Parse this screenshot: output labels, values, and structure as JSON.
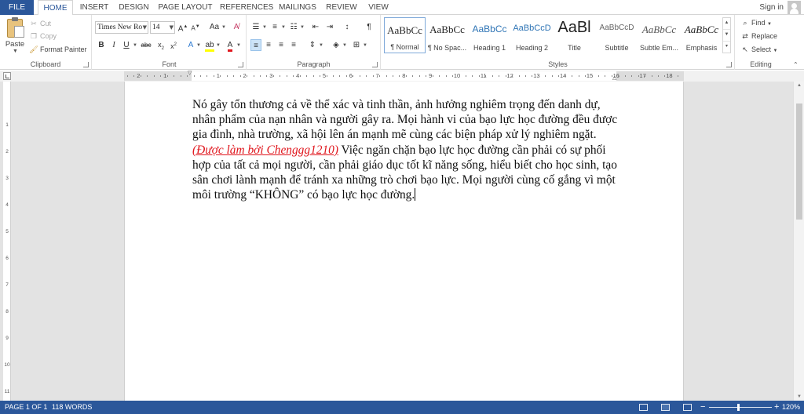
{
  "tabs": [
    "FILE",
    "HOME",
    "INSERT",
    "DESIGN",
    "PAGE LAYOUT",
    "REFERENCES",
    "MAILINGS",
    "REVIEW",
    "VIEW"
  ],
  "signin": "Sign in",
  "clipboard": {
    "label": "Clipboard",
    "paste": "Paste",
    "cut": "Cut",
    "copy": "Copy",
    "format_painter": "Format Painter"
  },
  "font": {
    "label": "Font",
    "name": "Times New Ro",
    "size": "14"
  },
  "paragraph": {
    "label": "Paragraph"
  },
  "styles": {
    "label": "Styles",
    "items": [
      {
        "preview": "AaBbCc",
        "name": "¶ Normal"
      },
      {
        "preview": "AaBbCc",
        "name": "¶ No Spac..."
      },
      {
        "preview": "AaBbCc",
        "name": "Heading 1"
      },
      {
        "preview": "AaBbCcD",
        "name": "Heading 2"
      },
      {
        "preview": "AaBl",
        "name": "Title"
      },
      {
        "preview": "AaBbCcD",
        "name": "Subtitle"
      },
      {
        "preview": "AaBbCc",
        "name": "Subtle Em..."
      },
      {
        "preview": "AaBbCc",
        "name": "Emphasis"
      }
    ]
  },
  "editing": {
    "label": "Editing",
    "find": "Find",
    "replace": "Replace",
    "select": "Select"
  },
  "ruler_numbers": [
    "2",
    "1",
    "1",
    "2",
    "3",
    "4",
    "5",
    "6",
    "7",
    "8",
    "9",
    "10",
    "11",
    "12",
    "13",
    "14",
    "15",
    "16",
    "17",
    "18"
  ],
  "vruler_numbers": [
    "1",
    "2",
    "3",
    "4",
    "5",
    "6",
    "7",
    "8",
    "9",
    "10",
    "11"
  ],
  "document": {
    "text_before": "Nó gây tổn thương cả về thể xác và tinh thần, ảnh hưởng nghiêm trọng đến danh dự, nhân phẩm của nạn nhân và người gây ra. Mọi hành vi của bạo lực học đường đều được gia đình, nhà trường, xã hội lên án mạnh mẽ cùng các biện pháp xử lý nghiêm ngặt. ",
    "highlight": "(Được làm bởi Chenggg1210)",
    "text_after": " Việc ngăn chặn bạo lực học đường cần phải có sự phối hợp của tất cả mọi người, cần phải giáo dục tốt kĩ năng sống, hiểu biết cho học sinh, tạo sân chơi lành mạnh để tránh xa những trò chơi bạo lực. Mọi người cùng cố gắng vì một môi trường “KHÔNG” có bạo lực học đường."
  },
  "status": {
    "page": "PAGE 1 OF 1",
    "words": "118 WORDS",
    "zoom": "120%"
  }
}
